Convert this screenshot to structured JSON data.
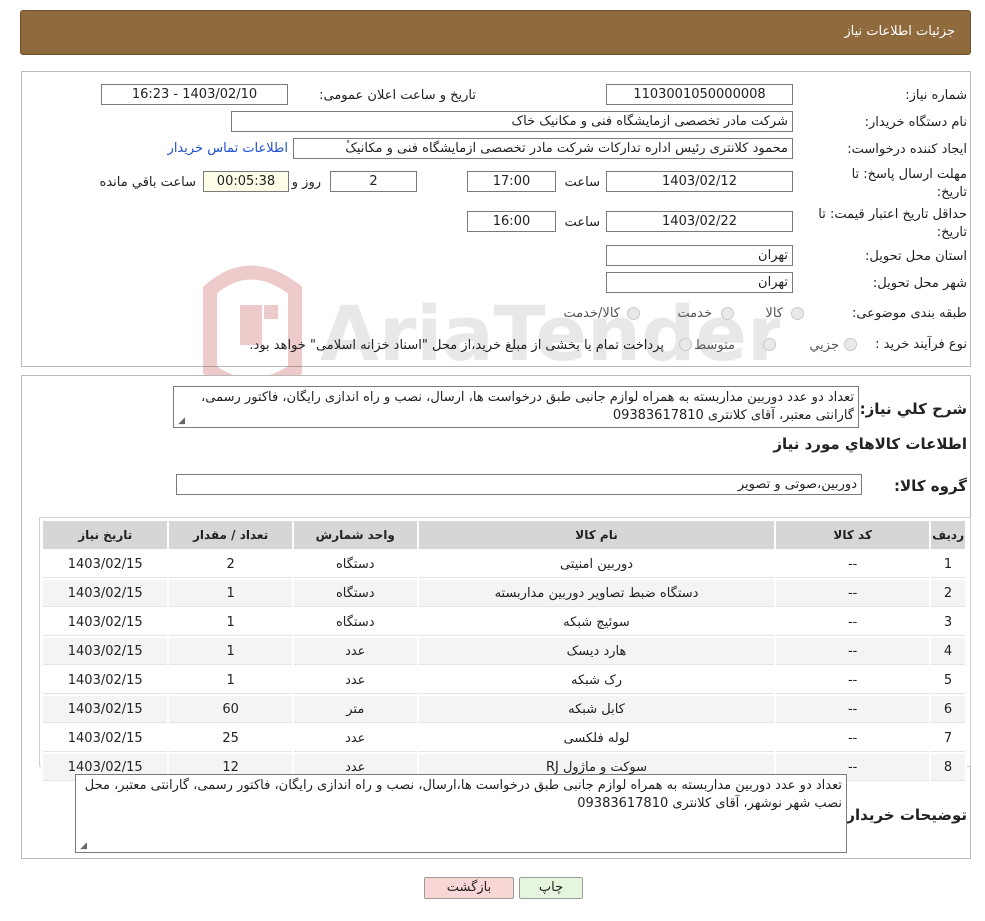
{
  "header": {
    "title": "جزئیات اطلاعات نیاز"
  },
  "form": {
    "need_number_label": "شماره نیاز:",
    "need_number": "1103001050000008",
    "announce_label": "تاریخ و ساعت اعلان عمومی:",
    "announce_value": "1403/02/10 - 16:23",
    "buyer_org_label": "نام دستگاه خریدار:",
    "buyer_org": "شرکت مادر تخصصی ازمایشگاه فنی و مکانیک خاک",
    "creator_label": "ایجاد کننده درخواست:",
    "creator": "محمود کلانتری رئیس اداره تدارکات شرکت مادر تخصصی ازمایشگاه فنی و مکانیکٔ",
    "contact_link": "اطلاعات تماس خریدار",
    "deadline_label": "مهلت ارسال پاسخ: تا تاریخ:",
    "deadline_date": "1403/02/12",
    "time_label": "ساعت",
    "deadline_time": "17:00",
    "days_value": "2",
    "days_label": "روز و",
    "remaining_time": "00:05:38",
    "remaining_label": "ساعت باقي مانده",
    "validity_label": "حداقل تاریخ اعتبار قیمت: تا تاریخ:",
    "validity_date": "1403/02/22",
    "validity_time": "16:00",
    "province_label": "استان محل تحویل:",
    "province": "تهران",
    "city_label": "شهر محل تحویل:",
    "city": "تهران",
    "category_label": "طبقه بندی موضوعی:",
    "category_options": [
      "کالا",
      "خدمت",
      "کالا/خدمت"
    ],
    "process_label": "نوع فرآیند خرید :",
    "process_options": [
      "جزیي",
      "متوسط"
    ],
    "process_note": "پرداخت تمام یا بخشی از مبلغ خرید،از محل \"اسناد خزانه اسلامی\" خواهد بود."
  },
  "summary": {
    "label": "شرح کلي نياز:",
    "text": "تعداد دو عدد دوربین مداربسته به همراه لوازم جانبی طبق درخواست ها، ارسال، نصب و راه اندازی رایگان، فاکتور رسمی، گارانتی معتبر، آقای کلانتری 09383617810",
    "goods_info_title": "اطلاعات کالاهاي مورد نياز",
    "group_label": "گروه کالا:",
    "group_value": "دوربین،صوتی و تصویر"
  },
  "table": {
    "headers": [
      "ردیف",
      "کد کالا",
      "نام کالا",
      "واحد شمارش",
      "تعداد / مقدار",
      "تاریخ نیاز"
    ],
    "rows": [
      [
        "1",
        "--",
        "دوربین امنیتی",
        "دستگاه",
        "2",
        "1403/02/15"
      ],
      [
        "2",
        "--",
        "دستگاه ضبط تصاویر دوربین مداربسته",
        "دستگاه",
        "1",
        "1403/02/15"
      ],
      [
        "3",
        "--",
        "سوئیچ شبکه",
        "دستگاه",
        "1",
        "1403/02/15"
      ],
      [
        "4",
        "--",
        "هارد دیسک",
        "عدد",
        "1",
        "1403/02/15"
      ],
      [
        "5",
        "--",
        "رک شبکه",
        "عدد",
        "1",
        "1403/02/15"
      ],
      [
        "6",
        "--",
        "کابل شبکه",
        "متر",
        "60",
        "1403/02/15"
      ],
      [
        "7",
        "--",
        "لوله فلکسی",
        "عدد",
        "25",
        "1403/02/15"
      ],
      [
        "8",
        "--",
        "سوکت و ماژول RJ",
        "عدد",
        "12",
        "1403/02/15"
      ]
    ]
  },
  "buyer_notes": {
    "label": "توضیحات خریدار:",
    "text": "تعداد دو عدد دوربین مداربسته به همراه لوازم جانبی طبق درخواست ها،ارسال، نصب و راه اندازی رایگان، فاکتور رسمی، گارانتی معتبر، محل نصب شهر نوشهر، آقای کلانتری 09383617810"
  },
  "buttons": {
    "print": "چاپ",
    "back": "بازگشت"
  },
  "colors": {
    "header_bg": "#8e6a3d",
    "link": "#1f4fd1",
    "back_btn_bg": "#f9d6d6",
    "print_btn_bg": "#e6f6de"
  }
}
